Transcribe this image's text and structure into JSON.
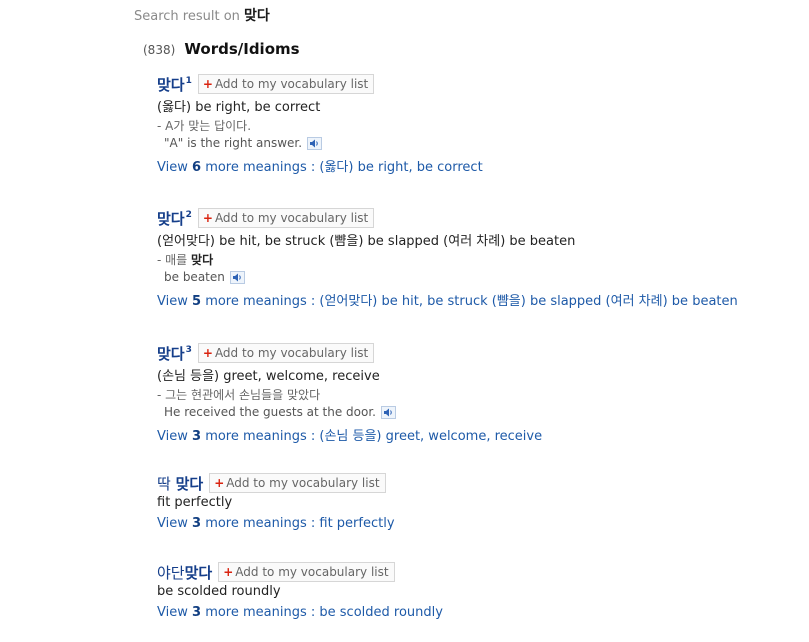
{
  "search": {
    "prefix": "Search result on",
    "query": "맞다"
  },
  "section": {
    "count": "(838)",
    "title": "Words/Idioms"
  },
  "add_label": "Add to my vocabulary list",
  "view_prefix": "View",
  "view_suffix": "more meanings :",
  "entries": [
    {
      "headword_prefix": "",
      "headword": "맞다",
      "sup": "1",
      "meaning": "(옳다) be right, be correct",
      "example_prefix": "- A가 맞는 답이다.",
      "example_kw": "",
      "example_suffix": "",
      "translation": "\"A\" is the right answer.",
      "more_count": "6",
      "more_text": "(옳다) be right, be correct"
    },
    {
      "headword_prefix": "",
      "headword": "맞다",
      "sup": "2",
      "meaning": "(얻어맞다) be hit, be struck (뺨을) be slapped (여러 차례) be beaten",
      "example_prefix": "- 매를 ",
      "example_kw": "맞다",
      "example_suffix": "",
      "translation": "be beaten",
      "more_count": "5",
      "more_text": "(얻어맞다) be hit, be struck (뺨을) be slapped (여러 차례) be beaten"
    },
    {
      "headword_prefix": "",
      "headword": "맞다",
      "sup": "3",
      "meaning": "(손님 등을) greet, welcome, receive",
      "example_prefix": "- 그는 현관에서 손님들을 맞았다",
      "example_kw": "",
      "example_suffix": "",
      "translation": "He received the guests at the door.",
      "more_count": "3",
      "more_text": "(손님 등을) greet, welcome, receive"
    },
    {
      "headword_prefix": "딱 ",
      "headword": "맞다",
      "sup": "",
      "meaning": "fit perfectly",
      "more_count": "3",
      "more_text": "fit perfectly"
    },
    {
      "headword_prefix": "야단",
      "headword": "맞다",
      "sup": "",
      "meaning": "be scolded roundly",
      "more_count": "3",
      "more_text": "be scolded roundly"
    }
  ]
}
